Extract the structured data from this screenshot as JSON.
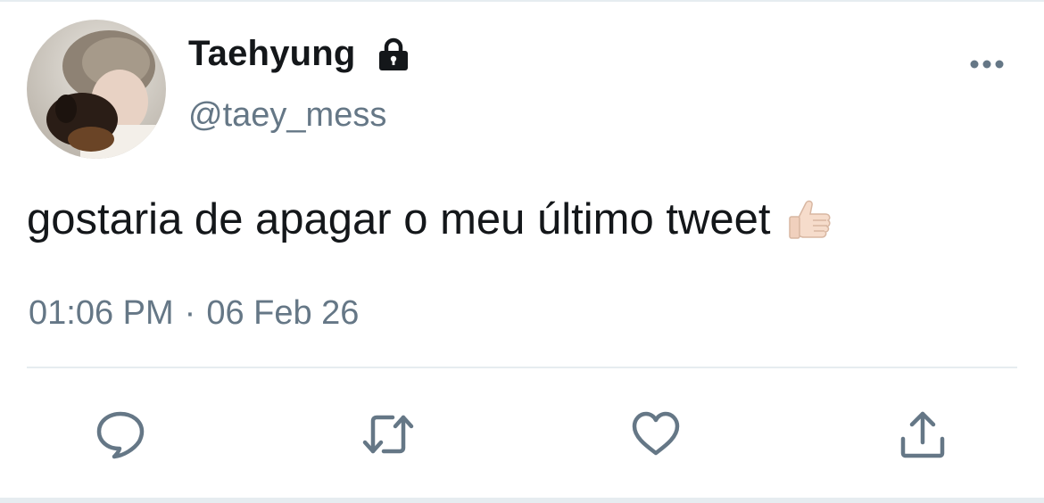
{
  "user": {
    "display_name": "Taehyung",
    "handle": "@taey_mess",
    "protected_icon": "lock-icon",
    "avatar": "avatar-photo"
  },
  "tweet": {
    "text": "gostaria de apagar o meu último tweet",
    "emoji": "thumbs-up-light-skin",
    "time": "01:06 PM",
    "separator": "·",
    "date": "06 Feb 26"
  },
  "actions": [
    {
      "name": "reply",
      "icon": "speech-bubble-icon"
    },
    {
      "name": "retweet",
      "icon": "retweet-icon"
    },
    {
      "name": "like",
      "icon": "heart-icon"
    },
    {
      "name": "share",
      "icon": "share-icon"
    }
  ],
  "menu": {
    "icon": "more-options-icon"
  },
  "colors": {
    "text_primary": "#14171a",
    "text_secondary": "#657786",
    "divider": "#e6ecf0",
    "icon": "#657786"
  }
}
